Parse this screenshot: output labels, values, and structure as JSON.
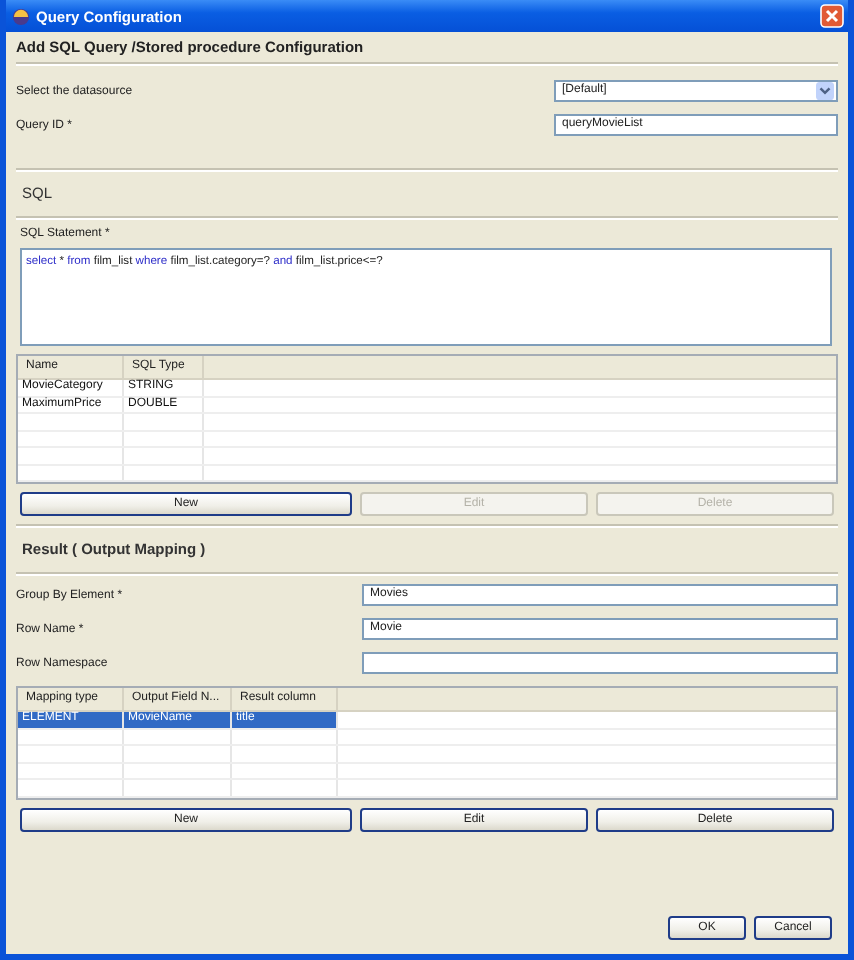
{
  "window": {
    "title": "Query Configuration"
  },
  "header": "Add SQL Query /Stored procedure Configuration",
  "general_fields": [
    {
      "kind": "dropdown",
      "label": "Select the datasource",
      "value": "[Default]"
    },
    {
      "kind": "text",
      "label": "Query ID *",
      "value": "queryMovieList"
    }
  ],
  "sql_section": {
    "title": "SQL",
    "statement_label": "SQL Statement *",
    "statement_tokens": [
      {
        "text": "select",
        "kind": "keyword"
      },
      {
        "text": " * ",
        "kind": "plain"
      },
      {
        "text": "from",
        "kind": "keyword"
      },
      {
        "text": " film_list ",
        "kind": "plain"
      },
      {
        "text": "where",
        "kind": "keyword"
      },
      {
        "text": " film_list.category=? ",
        "kind": "plain"
      },
      {
        "text": "and",
        "kind": "keyword"
      },
      {
        "text": " film_list.price<=?",
        "kind": "plain"
      }
    ],
    "parameters": {
      "columns": [
        "Name",
        "SQL Type"
      ],
      "rows": [
        {
          "cells": [
            "MovieCategory",
            "STRING"
          ],
          "selected": false
        },
        {
          "cells": [
            "MaximumPrice",
            "DOUBLE"
          ],
          "selected": false
        }
      ]
    },
    "buttons": [
      {
        "label": "New",
        "disabled": false
      },
      {
        "label": "Edit",
        "disabled": true
      },
      {
        "label": "Delete",
        "disabled": true
      }
    ]
  },
  "result_section": {
    "title": "Result ( Output Mapping )",
    "fields": [
      {
        "label": "Group By Element *",
        "value": "Movies"
      },
      {
        "label": "Row Name *",
        "value": "Movie"
      },
      {
        "label": "Row Namespace"
      }
    ],
    "mappings": {
      "columns": [
        "Mapping type",
        "Output Field N...",
        "Result column"
      ],
      "rows": [
        {
          "cells": [
            "ELEMENT",
            "MovieName",
            "title"
          ],
          "selected": true
        }
      ]
    },
    "buttons": [
      {
        "label": "New",
        "disabled": false
      },
      {
        "label": "Edit",
        "disabled": false
      },
      {
        "label": "Delete",
        "disabled": false
      }
    ]
  },
  "dialog_buttons": [
    {
      "label": "OK",
      "disabled": false
    },
    {
      "label": "Cancel",
      "disabled": false
    }
  ]
}
